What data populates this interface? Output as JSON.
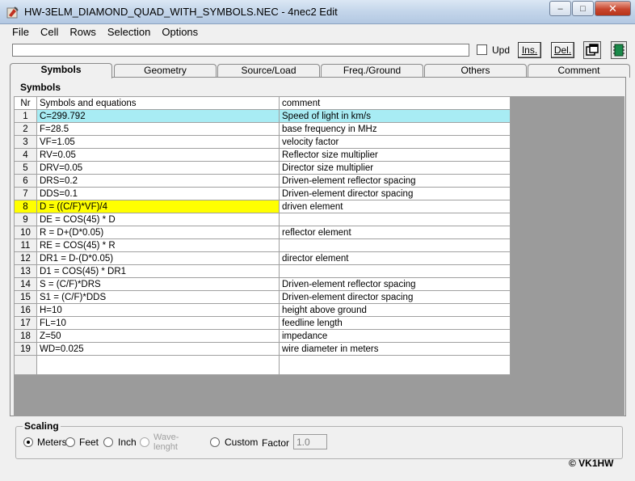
{
  "window": {
    "title": "HW-3ELM_DIAMOND_QUAD_WITH_SYMBOLS.NEC - 4nec2 Edit",
    "minimize_glyph": "–",
    "maximize_glyph": "□",
    "close_glyph": "✕"
  },
  "menu": [
    "File",
    "Cell",
    "Rows",
    "Selection",
    "Options"
  ],
  "toolbar": {
    "edit_value": "",
    "upd_label": "Upd",
    "upd_checked": false,
    "ins_label": "Ins.",
    "del_label": "Del."
  },
  "tabs": [
    "Symbols",
    "Geometry",
    "Source/Load",
    "Freq./Ground",
    "Others",
    "Comment"
  ],
  "active_tab": "Symbols",
  "section_label": "Symbols",
  "grid": {
    "headers": {
      "nr": "Nr",
      "expr": "Symbols and equations",
      "comment": "comment"
    },
    "rows": [
      {
        "nr": "1",
        "expr": "C=299.792",
        "comment": "Speed of light in km/s"
      },
      {
        "nr": "2",
        "expr": "F=28.5",
        "comment": "base frequency in MHz"
      },
      {
        "nr": "3",
        "expr": "VF=1.05",
        "comment": "velocity factor"
      },
      {
        "nr": "4",
        "expr": "RV=0.05",
        "comment": "Reflector size multiplier"
      },
      {
        "nr": "5",
        "expr": "DRV=0.05",
        "comment": "Director size multiplier"
      },
      {
        "nr": "6",
        "expr": "DRS=0.2",
        "comment": "Driven-element reflector spacing"
      },
      {
        "nr": "7",
        "expr": "DDS=0.1",
        "comment": "Driven-element director spacing"
      },
      {
        "nr": "8",
        "expr": "D = ((C/F)*VF)/4",
        "comment": "driven element"
      },
      {
        "nr": "9",
        "expr": "DE = COS(45) * D",
        "comment": ""
      },
      {
        "nr": "10",
        "expr": "R = D+(D*0.05)",
        "comment": "reflector element"
      },
      {
        "nr": "11",
        "expr": "RE = COS(45) * R",
        "comment": ""
      },
      {
        "nr": "12",
        "expr": "DR1 = D-(D*0.05)",
        "comment": "director element"
      },
      {
        "nr": "13",
        "expr": "D1 = COS(45) * DR1",
        "comment": ""
      },
      {
        "nr": "14",
        "expr": "S = (C/F)*DRS",
        "comment": "Driven-element reflector spacing"
      },
      {
        "nr": "15",
        "expr": "S1 = (C/F)*DDS",
        "comment": "Driven-element director spacing"
      },
      {
        "nr": "16",
        "expr": "H=10",
        "comment": "height above ground"
      },
      {
        "nr": "17",
        "expr": "FL=10",
        "comment": "feedline length"
      },
      {
        "nr": "18",
        "expr": "Z=50",
        "comment": "impedance"
      },
      {
        "nr": "19",
        "expr": "WD=0.025",
        "comment": "wire diameter in meters"
      }
    ],
    "selected_row": "1",
    "highlighted_row": "8",
    "selected_color": "#a8ecf4",
    "highlight_color": "#ffff00"
  },
  "scaling": {
    "title": "Scaling",
    "options": [
      "Meters",
      "Feet",
      "Inch",
      "Wave-\nlenght",
      "Custom"
    ],
    "selected": "Meters",
    "factor_label": "Factor",
    "factor_value": "1.0"
  },
  "copyright": "© VK1HW"
}
